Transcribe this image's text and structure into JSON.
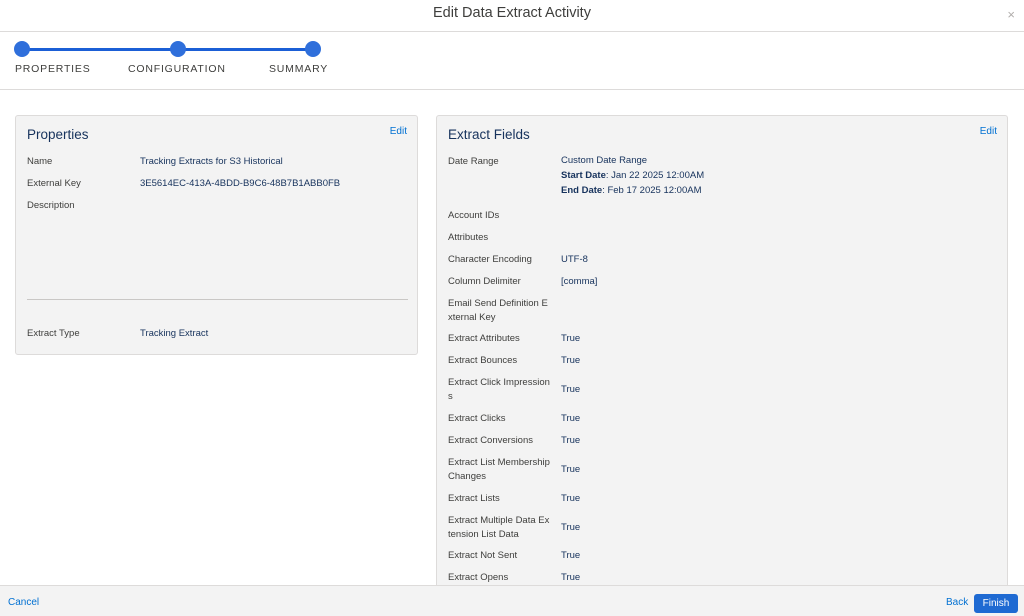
{
  "window": {
    "title": "Edit Data Extract Activity",
    "close_glyph": "×"
  },
  "steps": [
    {
      "label": "PROPERTIES"
    },
    {
      "label": "CONFIGURATION"
    },
    {
      "label": "SUMMARY"
    }
  ],
  "properties": {
    "title": "Properties",
    "edit_label": "Edit",
    "rows": [
      {
        "label": "Name",
        "value": "Tracking Extracts for S3 Historical"
      },
      {
        "label": "External Key",
        "value": "3E5614EC-413A-4BDD-B9C6-48B7B1ABB0FB"
      },
      {
        "label": "Description",
        "value": ""
      }
    ],
    "extract_type_label": "Extract Type",
    "extract_type_value": "Tracking Extract"
  },
  "extract_fields": {
    "title": "Extract Fields",
    "edit_label": "Edit",
    "date_range": {
      "label": "Date Range",
      "value": "Custom Date Range",
      "start_label": "Start Date",
      "start_value": ": Jan 22 2025 12:00AM",
      "end_label": "End Date",
      "end_value": ": Feb 17 2025 12:00AM"
    },
    "rows": [
      {
        "label": "Account IDs",
        "value": ""
      },
      {
        "label": "Attributes",
        "value": ""
      },
      {
        "label": "Character Encoding",
        "value": "UTF-8"
      },
      {
        "label": "Column Delimiter",
        "value": "[comma]"
      },
      {
        "label": "Email Send Definition E\nxternal Key",
        "value": ""
      },
      {
        "label": "Extract Attributes",
        "value": "True"
      },
      {
        "label": "Extract Bounces",
        "value": "True"
      },
      {
        "label": "Extract Click Impression\ns",
        "value": "True"
      },
      {
        "label": "Extract Clicks",
        "value": "True"
      },
      {
        "label": "Extract Conversions",
        "value": "True"
      },
      {
        "label": "Extract List Membership\nChanges",
        "value": "True"
      },
      {
        "label": "Extract Lists",
        "value": "True"
      },
      {
        "label": "Extract Multiple Data Ex\ntension List Data",
        "value": "True"
      },
      {
        "label": "Extract Not Sent",
        "value": "True"
      },
      {
        "label": "Extract Opens",
        "value": "True"
      }
    ]
  },
  "footer": {
    "cancel_label": "Cancel",
    "back_label": "Back",
    "finish_label": "Finish"
  }
}
